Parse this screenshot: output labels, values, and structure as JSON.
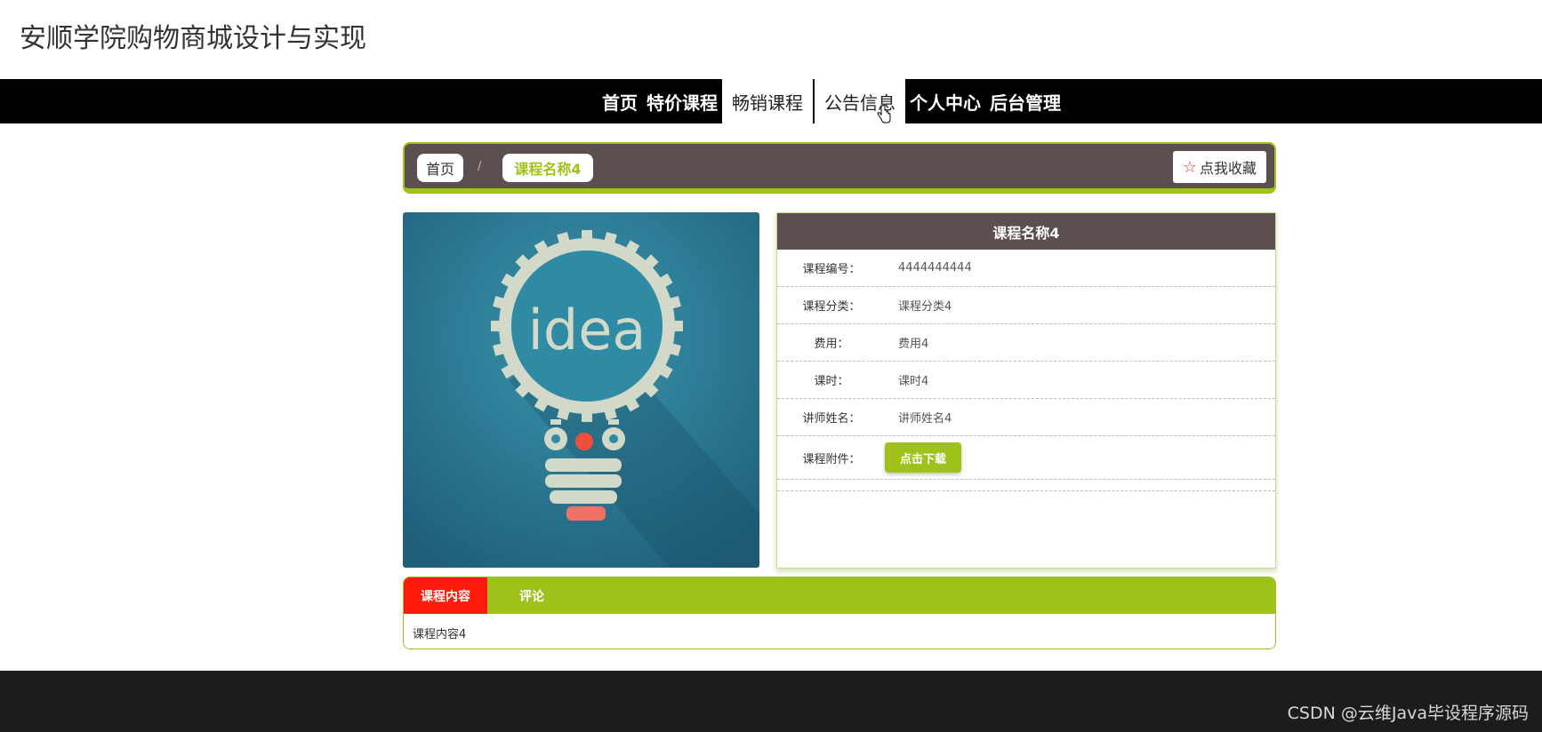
{
  "site": {
    "title": "安顺学院购物商城设计与实现"
  },
  "nav": {
    "items": [
      "首页",
      "特价课程",
      "畅销课程",
      "公告信息",
      "个人中心",
      "后台管理"
    ]
  },
  "breadcrumb": {
    "home": "首页",
    "separator": "/",
    "current": "课程名称4"
  },
  "favorite": {
    "label": "点我收藏",
    "icon": "star-outline-icon"
  },
  "course": {
    "name": "课程名称4",
    "image": {
      "label": "idea",
      "icon": "lightbulb-gear-icon"
    },
    "fields": [
      {
        "label": "课程编号：",
        "value": "4444444444"
      },
      {
        "label": "课程分类：",
        "value": "课程分类4"
      },
      {
        "label": "费用：",
        "value": "费用4"
      },
      {
        "label": "课时：",
        "value": "课时4"
      },
      {
        "label": "讲师姓名：",
        "value": "讲师姓名4"
      }
    ],
    "attachment": {
      "label": "课程附件：",
      "button": "点击下载"
    }
  },
  "tabs": {
    "items": [
      "课程内容",
      "评论"
    ],
    "active": 0,
    "content": "课程内容4"
  },
  "footer": {
    "watermark": "CSDN @云维Java毕设程序源码"
  },
  "colors": {
    "accent": "#9ec21a",
    "header": "#5b4f4f",
    "active_tab": "#ff1a0a",
    "nav": "#000000",
    "footer": "#1c1c1c"
  }
}
